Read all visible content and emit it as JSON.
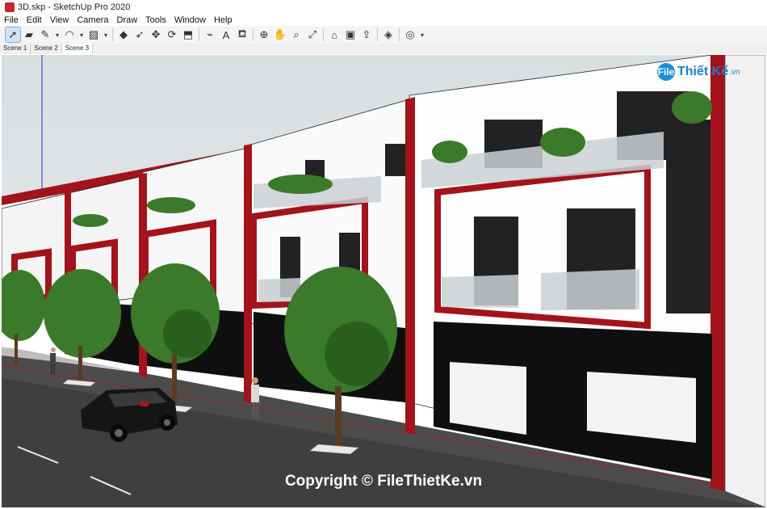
{
  "window": {
    "title": "3D.skp - SketchUp Pro 2020"
  },
  "menu": [
    "File",
    "Edit",
    "View",
    "Camera",
    "Draw",
    "Tools",
    "Window",
    "Help"
  ],
  "toolbar": [
    {
      "icon": "select-arrow-icon",
      "glyph": "➚",
      "selected": true
    },
    {
      "icon": "eraser-icon",
      "glyph": "▰"
    },
    {
      "icon": "pencil-line-icon",
      "glyph": "✎"
    },
    {
      "icon": "dropdown-arrow-icon",
      "glyph": "▾"
    },
    {
      "icon": "arc-icon",
      "glyph": "◠"
    },
    {
      "icon": "dropdown-arrow-icon",
      "glyph": "▾"
    },
    {
      "icon": "shape-rectangle-icon",
      "glyph": "▨"
    },
    {
      "icon": "dropdown-arrow-icon",
      "glyph": "▾"
    },
    {
      "sep": true
    },
    {
      "icon": "push-pull-icon",
      "glyph": "◆"
    },
    {
      "icon": "follow-me-icon",
      "glyph": "➶"
    },
    {
      "icon": "move-icon",
      "glyph": "✥"
    },
    {
      "icon": "rotate-icon",
      "glyph": "⟳"
    },
    {
      "icon": "scale-icon",
      "glyph": "⬒"
    },
    {
      "sep": true
    },
    {
      "icon": "tape-measure-icon",
      "glyph": "⌁"
    },
    {
      "icon": "text-label-icon",
      "glyph": "A"
    },
    {
      "icon": "paint-bucket-icon",
      "glyph": "⛾"
    },
    {
      "sep": true
    },
    {
      "icon": "orbit-icon",
      "glyph": "⊕"
    },
    {
      "icon": "pan-hand-icon",
      "glyph": "✋"
    },
    {
      "icon": "zoom-icon",
      "glyph": "⌕"
    },
    {
      "icon": "zoom-extents-icon",
      "glyph": "⤢"
    },
    {
      "sep": true
    },
    {
      "icon": "warehouse-icon",
      "glyph": "⌂"
    },
    {
      "icon": "extension-warehouse-icon",
      "glyph": "▣"
    },
    {
      "icon": "share-model-icon",
      "glyph": "⇪"
    },
    {
      "sep": true
    },
    {
      "icon": "ruby-extension-icon",
      "glyph": "◈"
    },
    {
      "sep": true
    },
    {
      "icon": "account-icon",
      "glyph": "◎"
    },
    {
      "icon": "dropdown-arrow-icon",
      "glyph": "▾"
    }
  ],
  "scenes": [
    {
      "label": "Scene 1",
      "active": false
    },
    {
      "label": "Scene 2",
      "active": false
    },
    {
      "label": "Scene 3",
      "active": true
    }
  ],
  "logo": {
    "badge": "File",
    "name": "Thiết Kế",
    "tld": ".vn"
  },
  "watermark": "Copyright © FileThietKe.vn",
  "colors": {
    "accent_red": "#a3131b",
    "toolbar_bg": "#f4f4f4",
    "sky": "#dfe4e6",
    "road": "#3d3d3d",
    "tree": "#3a7a2a"
  }
}
